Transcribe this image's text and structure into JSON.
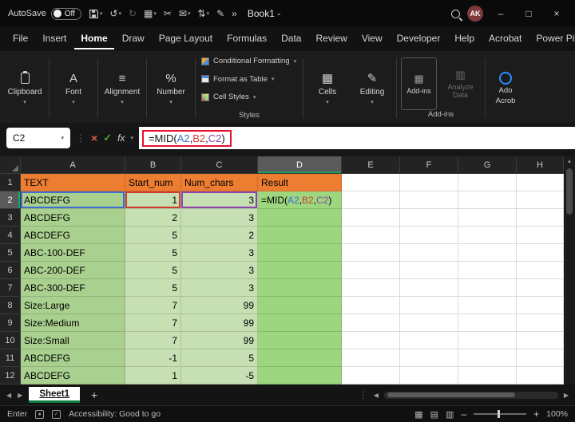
{
  "colors": {
    "accent_green": "#21A366",
    "excel_green": "#107C41",
    "header_fill": "#ED7D31",
    "col_a_fill": "#A9D08E",
    "col_bc_fill": "#C6E0B4",
    "col_d_fill": "#9CD67E",
    "ref_blue": "#3E6FD0",
    "ref_red": "#D03B30",
    "ref_purple": "#8E44AD",
    "annotation_red": "#E8112D",
    "avatar_bg": "#7E3A3A"
  },
  "titlebar": {
    "autosave_label": "AutoSave",
    "autosave_state": "Off",
    "title": "Book1 -",
    "more_commands": "»",
    "avatar_initials": "AK",
    "minimize_glyph": "–",
    "restore_glyph": "□",
    "close_glyph": "×"
  },
  "menubar": {
    "items": [
      "File",
      "Insert",
      "Home",
      "Draw",
      "Page Layout",
      "Formulas",
      "Data",
      "Review",
      "View",
      "Developer",
      "Help",
      "Acrobat",
      "Power Pivot"
    ],
    "active": "Home"
  },
  "ribbon": {
    "groups": [
      {
        "label": "Clipboard"
      },
      {
        "label": "Font"
      },
      {
        "label": "Alignment"
      },
      {
        "label": "Number"
      }
    ],
    "styles": {
      "items": [
        "Conditional Formatting",
        "Format as Table",
        "Cell Styles"
      ],
      "caption": "Styles"
    },
    "cells_label": "Cells",
    "editing_label": "Editing",
    "addins_button": "Add-ins",
    "analyze_button": "Analyze Data",
    "addins_caption": "Add-ins",
    "acrobat_line1": "Ado",
    "acrobat_line2": "Acrob"
  },
  "formulabar": {
    "name_box": "C2",
    "cancel_glyph": "×",
    "enter_glyph": "✓",
    "fx_label": "fx",
    "formula": {
      "prefix": "=MID(",
      "ref1": "A2",
      "comma1": ",",
      "ref2": "B2",
      "comma2": ",",
      "ref3": "C2",
      "suffix": ")"
    }
  },
  "grid": {
    "column_headers": [
      "A",
      "B",
      "C",
      "D",
      "E",
      "F",
      "G",
      "H"
    ],
    "active_column": "D",
    "active_row": 2,
    "rows": [
      {
        "n": 1,
        "type": "header",
        "a": "TEXT",
        "b": "Start_num",
        "c": "Num_chars",
        "d": "Result"
      },
      {
        "n": 2,
        "a": "ABCDEFG",
        "b": "1",
        "c": "3",
        "d": "=MID(A2,B2,C2)"
      },
      {
        "n": 3,
        "a": "ABCDEFG",
        "b": "2",
        "c": "3",
        "d": ""
      },
      {
        "n": 4,
        "a": "ABCDEFG",
        "b": "5",
        "c": "2",
        "d": ""
      },
      {
        "n": 5,
        "a": "ABC-100-DEF",
        "b": "5",
        "c": "3",
        "d": ""
      },
      {
        "n": 6,
        "a": "ABC-200-DEF",
        "b": "5",
        "c": "3",
        "d": ""
      },
      {
        "n": 7,
        "a": "ABC-300-DEF",
        "b": "5",
        "c": "3",
        "d": ""
      },
      {
        "n": 8,
        "a": "Size:Large",
        "b": "7",
        "c": "99",
        "d": ""
      },
      {
        "n": 9,
        "a": "Size:Medium",
        "b": "7",
        "c": "99",
        "d": ""
      },
      {
        "n": 10,
        "a": "Size:Small",
        "b": "7",
        "c": "99",
        "d": ""
      },
      {
        "n": 11,
        "a": "ABCDEFG",
        "b": "-1",
        "c": "5",
        "d": ""
      },
      {
        "n": 12,
        "a": "ABCDEFG",
        "b": "1",
        "c": "-5",
        "d": ""
      }
    ],
    "ref_outlines": [
      {
        "row": 2,
        "col": "a",
        "color": "ref_blue"
      },
      {
        "row": 2,
        "col": "b",
        "color": "ref_red"
      },
      {
        "row": 2,
        "col": "c",
        "color": "ref_purple"
      }
    ]
  },
  "sheetbar": {
    "tabs": [
      "Sheet1"
    ],
    "active_tab": "Sheet1",
    "add_label": "+"
  },
  "statusbar": {
    "mode": "Enter",
    "accessibility": "Accessibility: Good to go",
    "zoom": "100%"
  }
}
